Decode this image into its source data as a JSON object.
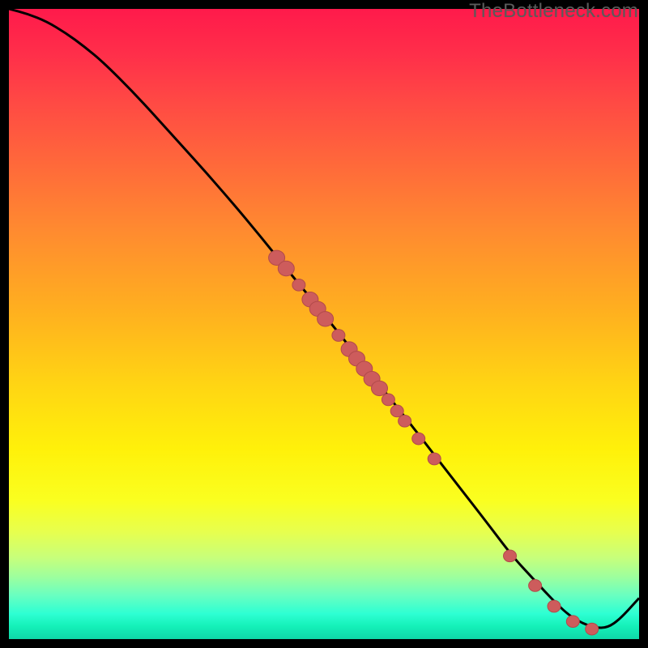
{
  "watermark": "TheBottleneck.com",
  "colors": {
    "line": "#000000",
    "dot_fill": "#cd5c5c",
    "dot_stroke": "#b24a4a"
  },
  "chart_data": {
    "type": "line",
    "title": "",
    "xlabel": "",
    "ylabel": "",
    "xlim": [
      0,
      100
    ],
    "ylim": [
      0,
      100
    ],
    "note": "x and y are percentages of the inner plot area (origin bottom-left); the visible curve occupies the full plot with no numeric axes rendered.",
    "series": [
      {
        "name": "bottleneck-curve",
        "x": [
          0,
          3,
          6,
          9,
          12,
          15,
          20,
          25,
          30,
          35,
          40,
          45,
          50,
          55,
          60,
          65,
          70,
          75,
          80,
          83,
          85,
          87,
          89,
          91,
          93,
          95,
          97,
          100
        ],
        "y": [
          100,
          99.2,
          98.0,
          96.2,
          94.0,
          91.5,
          86.5,
          81.0,
          75.5,
          69.8,
          63.8,
          57.6,
          51.5,
          45.2,
          38.8,
          32.5,
          26.0,
          19.6,
          13.0,
          9.8,
          7.6,
          5.5,
          3.7,
          2.5,
          1.8,
          1.8,
          3.2,
          6.5
        ]
      }
    ],
    "marker_points": {
      "note": "positions along the curve where red markers are drawn; x,y in same percentage coordinates",
      "points": [
        {
          "x": 42.5,
          "y": 60.5,
          "size": "large"
        },
        {
          "x": 44.0,
          "y": 58.8,
          "size": "large"
        },
        {
          "x": 46.0,
          "y": 56.2,
          "size": "small"
        },
        {
          "x": 47.8,
          "y": 53.9,
          "size": "large"
        },
        {
          "x": 49.0,
          "y": 52.4,
          "size": "large"
        },
        {
          "x": 50.2,
          "y": 50.8,
          "size": "large"
        },
        {
          "x": 52.3,
          "y": 48.2,
          "size": "small"
        },
        {
          "x": 54.0,
          "y": 46.0,
          "size": "large"
        },
        {
          "x": 55.2,
          "y": 44.5,
          "size": "large"
        },
        {
          "x": 56.4,
          "y": 42.9,
          "size": "large"
        },
        {
          "x": 57.6,
          "y": 41.3,
          "size": "large"
        },
        {
          "x": 58.8,
          "y": 39.8,
          "size": "large"
        },
        {
          "x": 60.2,
          "y": 38.0,
          "size": "small"
        },
        {
          "x": 61.6,
          "y": 36.2,
          "size": "small"
        },
        {
          "x": 62.8,
          "y": 34.6,
          "size": "small"
        },
        {
          "x": 65.0,
          "y": 31.8,
          "size": "small"
        },
        {
          "x": 67.5,
          "y": 28.6,
          "size": "small"
        },
        {
          "x": 79.5,
          "y": 13.2,
          "size": "small"
        },
        {
          "x": 83.5,
          "y": 8.5,
          "size": "small"
        },
        {
          "x": 86.5,
          "y": 5.2,
          "size": "small"
        },
        {
          "x": 89.5,
          "y": 2.8,
          "size": "small"
        },
        {
          "x": 92.5,
          "y": 1.6,
          "size": "small"
        }
      ]
    }
  }
}
